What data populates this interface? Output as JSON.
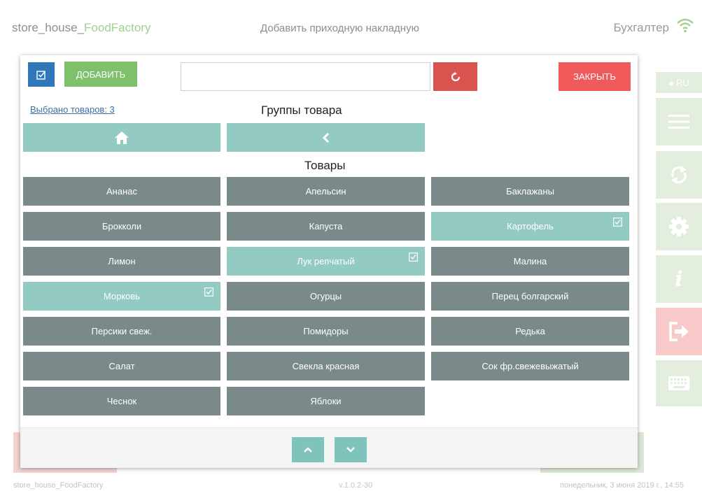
{
  "header": {
    "brand_main": "store_house_",
    "brand_accent": "FoodFactory",
    "title": "Добавить приходную накладную",
    "user": "Бухгалтер"
  },
  "sidebar": {
    "language": "RU",
    "items": [
      {
        "icon": "menu-icon"
      },
      {
        "icon": "sync-icon"
      },
      {
        "icon": "gear-icon"
      },
      {
        "icon": "info-icon",
        "label": "i"
      },
      {
        "icon": "exit-icon"
      },
      {
        "icon": "keyboard-icon"
      }
    ]
  },
  "modal": {
    "add_label": "ДОБАВИТЬ",
    "search_value": "",
    "close_label": "ЗАКРЫТЬ",
    "selected_count_text": "Выбрано товаров: 3",
    "groups_title": "Группы товара",
    "products_title": "Товары",
    "products": [
      {
        "name": "Ананас",
        "selected": false
      },
      {
        "name": "Апельсин",
        "selected": false
      },
      {
        "name": "Баклажаны",
        "selected": false
      },
      {
        "name": "Брокколи",
        "selected": false
      },
      {
        "name": "Капуста",
        "selected": false
      },
      {
        "name": "Картофель",
        "selected": true
      },
      {
        "name": "Лимон",
        "selected": false
      },
      {
        "name": "Лук репчатый",
        "selected": true
      },
      {
        "name": "Малина",
        "selected": false
      },
      {
        "name": "Морковь",
        "selected": true
      },
      {
        "name": "Огурцы",
        "selected": false
      },
      {
        "name": "Перец болгарский",
        "selected": false
      },
      {
        "name": "Персики свеж.",
        "selected": false
      },
      {
        "name": "Помидоры",
        "selected": false
      },
      {
        "name": "Редька",
        "selected": false
      },
      {
        "name": "Салат",
        "selected": false
      },
      {
        "name": "Свекла красная",
        "selected": false
      },
      {
        "name": "Сок фр.свежевыжатый",
        "selected": false
      },
      {
        "name": "Чеснок",
        "selected": false
      },
      {
        "name": "Яблоки",
        "selected": false
      }
    ]
  },
  "footer": {
    "left": "store_house_FoodFactory",
    "center": "v.1.0.2-30",
    "right": "понедельник, 3 июня 2019 г., 14:55"
  },
  "colors": {
    "teal": "#93cbc3",
    "tile_gray": "#7a8a8b",
    "add_green": "#7ec06c",
    "close_red": "#f05a5a",
    "reset_red": "#d9534f",
    "select_blue": "#2f76bb"
  }
}
